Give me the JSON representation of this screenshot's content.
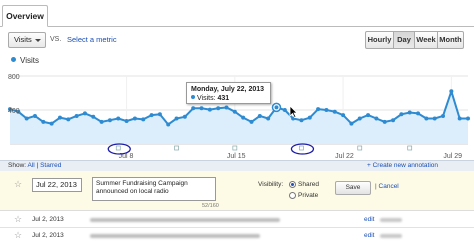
{
  "tabs": {
    "overview_label": "Overview"
  },
  "controls": {
    "metric_label": "Visits",
    "vs_label": "VS.",
    "select_metric_label": "Select a metric",
    "range_buttons": [
      "Hourly",
      "Day",
      "Week",
      "Month"
    ],
    "active_range": "Day"
  },
  "legend": {
    "series_label": "Visits",
    "series_color": "#2e8bd1"
  },
  "chart_data": {
    "type": "area",
    "series": [
      {
        "name": "Visits",
        "values": [
          410,
          380,
          300,
          330,
          260,
          240,
          310,
          290,
          330,
          360,
          320,
          260,
          280,
          300,
          270,
          300,
          290,
          340,
          350,
          230,
          300,
          320,
          420,
          420,
          405,
          420,
          430,
          380,
          310,
          260,
          330,
          300,
          431,
          400,
          300,
          280,
          310,
          410,
          400,
          380,
          340,
          240,
          300,
          340,
          300,
          260,
          280,
          350,
          370,
          360,
          300,
          300,
          330,
          620,
          300,
          300
        ]
      }
    ],
    "x_tick_labels": [
      "Jul 8",
      "Jul 15",
      "Jul 22",
      "Jul 29"
    ],
    "y_tick_labels": [
      "800",
      "400"
    ],
    "ylim": [
      0,
      800
    ],
    "grid": true
  },
  "tooltip": {
    "date": "Monday, July 22, 2013",
    "series": "Visits",
    "value": "431"
  },
  "showbar": {
    "show_label": "Show:",
    "all_label": "All",
    "separator": "|",
    "starred_label": "Starred",
    "create_label": "+ Create new annotation"
  },
  "annotation_form": {
    "date_value": "Jul 22, 2013",
    "note_value": "Summer Fundraising Campaign announced on local radio",
    "char_count": "52/160",
    "visibility_label": "Visibility:",
    "option_shared": "Shared",
    "option_private": "Private",
    "save_label": "Save",
    "separator": "|",
    "cancel_label": "Cancel"
  },
  "annotation_rows": [
    {
      "date": "Jul 2, 2013",
      "edit_label": "edit"
    },
    {
      "date": "Jul 2, 2013",
      "edit_label": "edit"
    }
  ]
}
